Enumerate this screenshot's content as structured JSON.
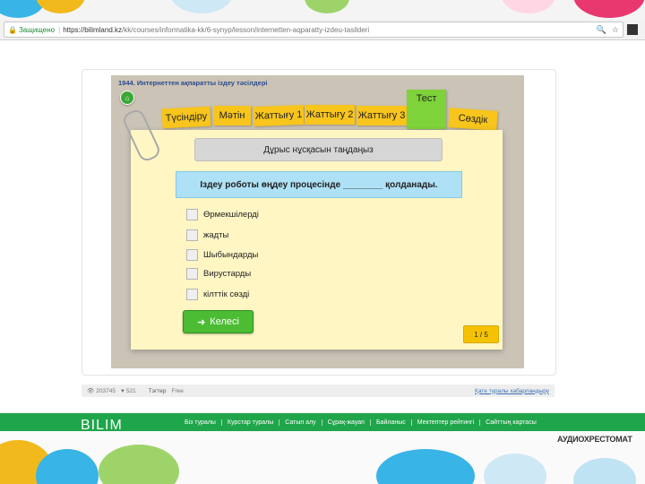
{
  "browser": {
    "secure_label": "Защищено",
    "url_host": "https://bilimland.kz",
    "url_path": "/kk/courses/informatika-kk/6-synyp/lesson/internetten-aqparatty-izdeu-tasilderi"
  },
  "lesson": {
    "title": "1944. Интернеттен ақпаратты іздеу тәсілдері",
    "tabs": [
      "Түсіндіру",
      "Мәтін",
      "Жаттығу 1",
      "Жаттығу 2",
      "Жаттығу 3",
      "Тест",
      "Сөздік"
    ],
    "active_tab": "Тест",
    "instruction": "Дұрыс нұсқасын таңдаңыз",
    "question": "Іздеу роботы өңдеу процесінде ________ қолданады.",
    "options": [
      "Өрмекшілерді",
      "жадты",
      "Шыбындарды",
      "Вирустарды",
      "кілттік сөзді"
    ],
    "next_label": "Келесі",
    "page_indicator": "1 / 5"
  },
  "stats": {
    "views": "203745",
    "likes": "521",
    "tags_label": "Тэгтер",
    "tag": "Free",
    "report_label": "Қате туралы хабарландыру"
  },
  "footer": {
    "logo": "BILIM",
    "links": [
      "Біз туралы",
      "Курстар туралы",
      "Сатып алу",
      "Сұрақ-жауап",
      "Байланыс",
      "Мектептер рейтингі",
      "Сайттың картасы"
    ],
    "audio_banner": "АУДИОХРЕСТОМАТ"
  },
  "colors": {
    "green": "#1fa54a",
    "tab_yellow": "#f8c51c",
    "tab_active": "#7ed33a",
    "sheet": "#fff6c4"
  }
}
